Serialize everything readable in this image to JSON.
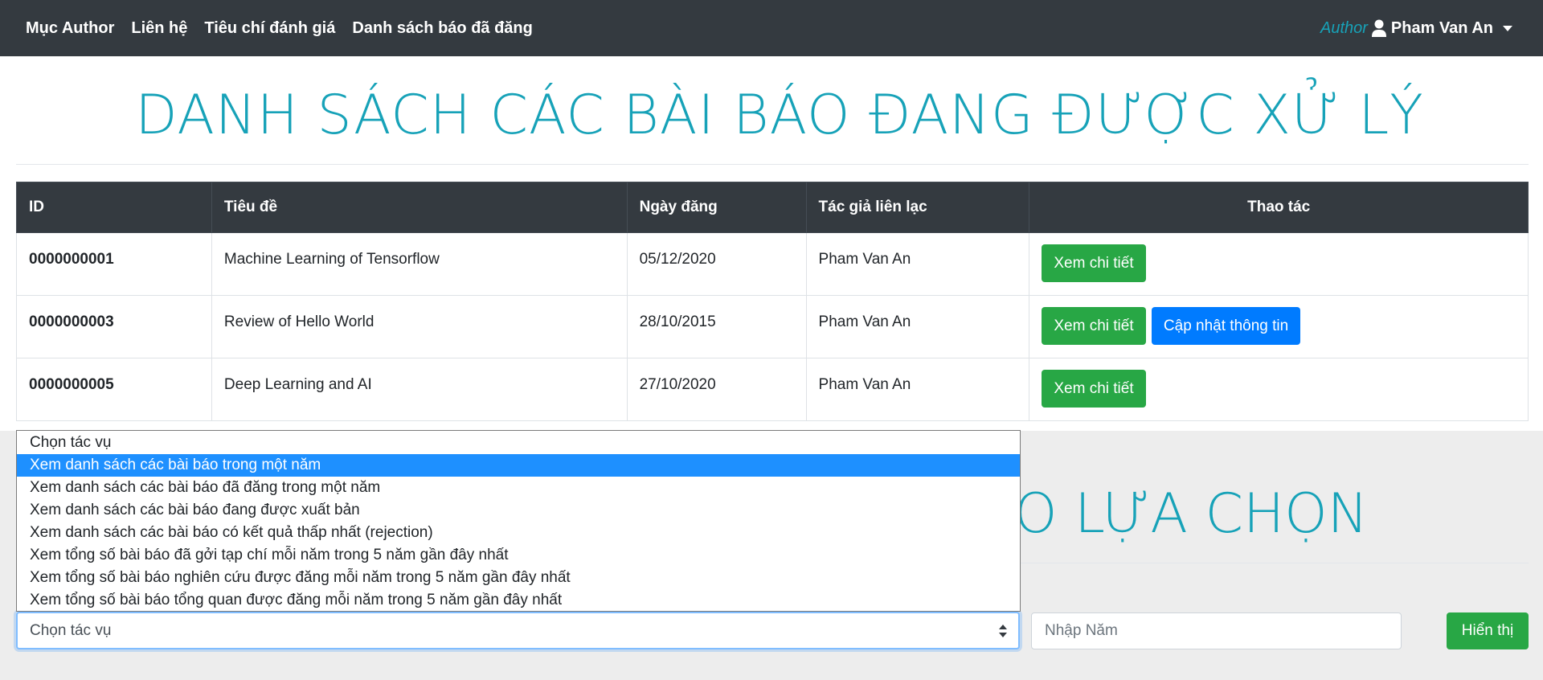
{
  "nav": {
    "links": [
      "Mục Author",
      "Liên hệ",
      "Tiêu chí đánh giá",
      "Danh sách báo đã đăng"
    ],
    "role": "Author",
    "user_name": "Pham Van An"
  },
  "page_title": "DANH SÁCH CÁC BÀI BÁO ĐANG ĐƯỢC XỬ LÝ",
  "table": {
    "headers": [
      "ID",
      "Tiêu đề",
      "Ngày đăng",
      "Tác giả liên lạc",
      "Thao tác"
    ],
    "rows": [
      {
        "id": "0000000001",
        "title": "Machine Learning of Tensorflow",
        "date": "05/12/2020",
        "author": "Pham Van An",
        "detail_label": "Xem chi tiết"
      },
      {
        "id": "0000000003",
        "title": "Review of Hello World",
        "date": "28/10/2015",
        "author": "Pham Van An",
        "detail_label": "Xem chi tiết",
        "update_label": "Cập nhật thông tin"
      },
      {
        "id": "0000000005",
        "title": "Deep Learning and AI",
        "date": "27/10/2020",
        "author": "Pham Van An",
        "detail_label": "Xem chi tiết"
      }
    ]
  },
  "section_title_partial": "O LỰA CHỌN",
  "form": {
    "select_value": "Chọn tác vụ",
    "year_placeholder": "Nhập Năm",
    "submit_label": "Hiển thị"
  },
  "dropdown": {
    "options": [
      "Chọn tác vụ",
      "Xem danh sách các bài báo trong một năm",
      "Xem danh sách các bài báo đã đăng trong một năm",
      "Xem danh sách các bài báo đang được xuất bản",
      "Xem danh sách các bài báo có kết quả thấp nhất (rejection)",
      "Xem tổng số bài báo đã gởi tạp chí mỗi năm trong 5 năm gần đây nhất",
      "Xem tổng số bài báo nghiên cứu được đăng mỗi năm trong 5 năm gần đây nhất",
      "Xem tổng số bài báo tổng quan được đăng mỗi năm trong 5 năm gần đây nhất"
    ],
    "highlighted": "Xem danh sách các bài báo trong một năm"
  },
  "colors": {
    "navbar": "#343a40",
    "accent": "#17a2b8",
    "success": "#28a745",
    "primary": "#007bff",
    "dropdown_highlight": "#1e90ff"
  }
}
